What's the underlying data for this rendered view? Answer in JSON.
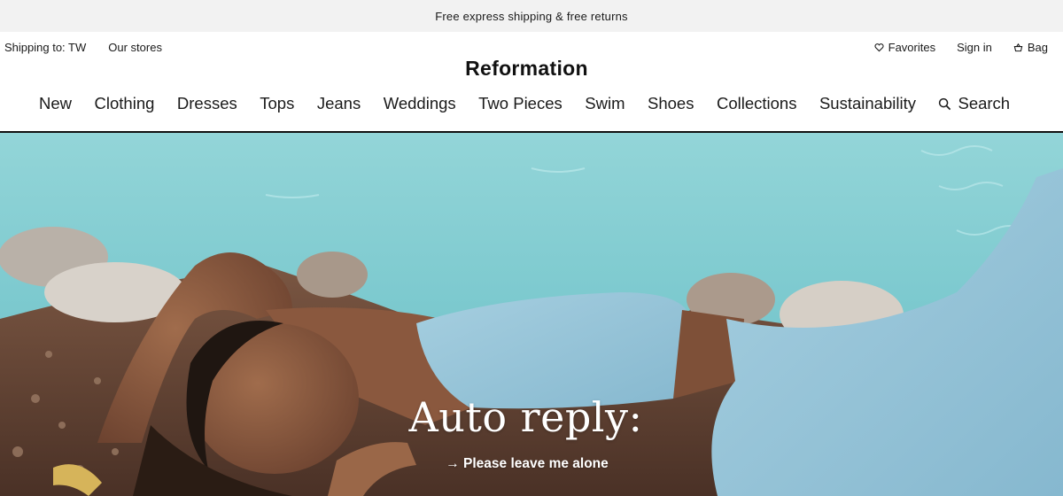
{
  "promo": {
    "text": "Free express shipping & free returns"
  },
  "utility": {
    "shipping_label": "Shipping to: TW",
    "stores_label": "Our stores",
    "favorites_label": "Favorites",
    "signin_label": "Sign in",
    "bag_label": "Bag"
  },
  "brand": {
    "logo_text": "Reformation"
  },
  "nav": {
    "items": [
      "New",
      "Clothing",
      "Dresses",
      "Tops",
      "Jeans",
      "Weddings",
      "Two Pieces",
      "Swim",
      "Shoes",
      "Collections",
      "Sustainability"
    ],
    "search_label": "Search"
  },
  "hero": {
    "title": "Auto reply:",
    "cta": "→ Please leave me alone"
  },
  "colors": {
    "water": "#7ecbd0",
    "fabric": "#9cc8dc",
    "skin": "#8a5a40",
    "rocks": "#6a4a38",
    "text": "#1a1a1a"
  },
  "icons": {
    "favorites": "heart-icon",
    "bag": "bag-icon",
    "search": "search-icon"
  }
}
